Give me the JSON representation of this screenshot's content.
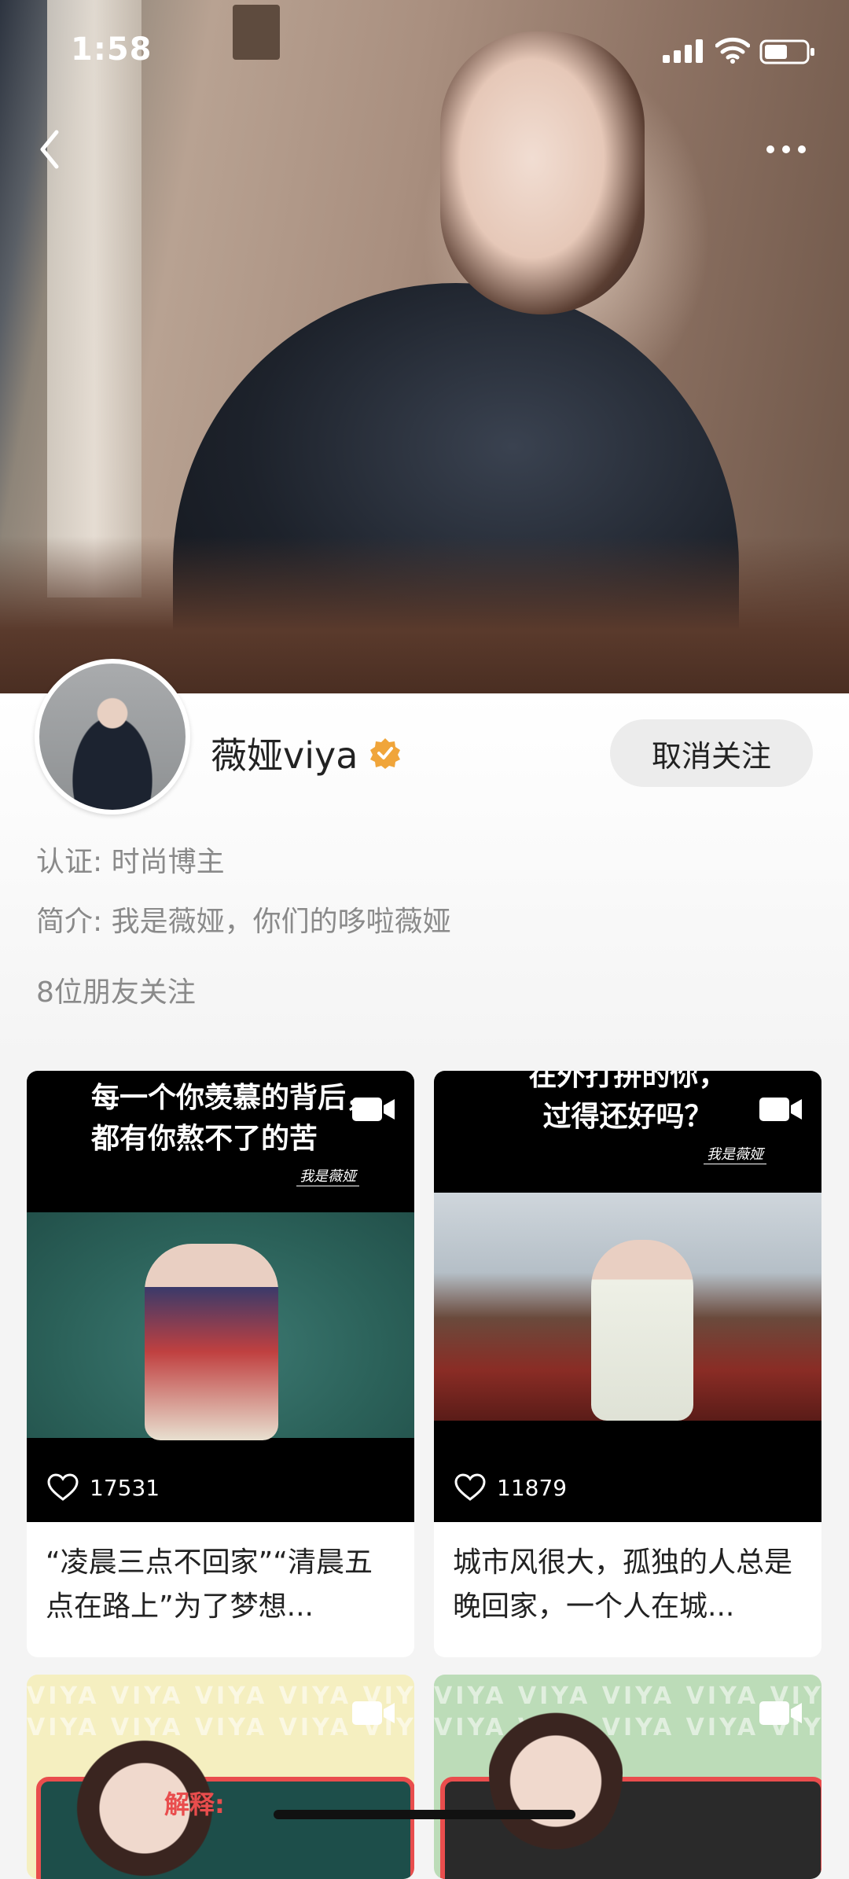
{
  "status_bar": {
    "time": "1:58"
  },
  "profile": {
    "name": "薇娅viya",
    "follow_button": "取消关注",
    "certification": "认证: 时尚博主",
    "intro": "简介: 我是薇娅，你们的哆啦薇娅",
    "friends": "8位朋友关注"
  },
  "posts": [
    {
      "caption": "每一个你羡慕的背后，\n都有你熬不了的苦",
      "sign": "我是薇娅",
      "likes": "17531",
      "title": "“凌晨三点不回家”“清晨五点在路上”为了梦想..."
    },
    {
      "caption": "在外打拼的你，\n过得还好吗？",
      "sign": "我是薇娅",
      "likes": "11879",
      "title": "城市风很大，孤独的人总是晚回家，一个人在城..."
    },
    {
      "pattern": "VIYA VIYA VIYA VIYA VIYA",
      "label": "解释:"
    },
    {
      "pattern": "VIYA VIYA VIYA VIYA VIYA"
    }
  ],
  "colors": {
    "verified_badge": "#f0a53a",
    "unfollow_bg": "#ececec",
    "muted_text": "#8a8a8a"
  },
  "icons": [
    "back-icon",
    "more-icon",
    "signal-icon",
    "wifi-icon",
    "battery-icon",
    "verified-icon",
    "video-icon",
    "heart-icon"
  ]
}
